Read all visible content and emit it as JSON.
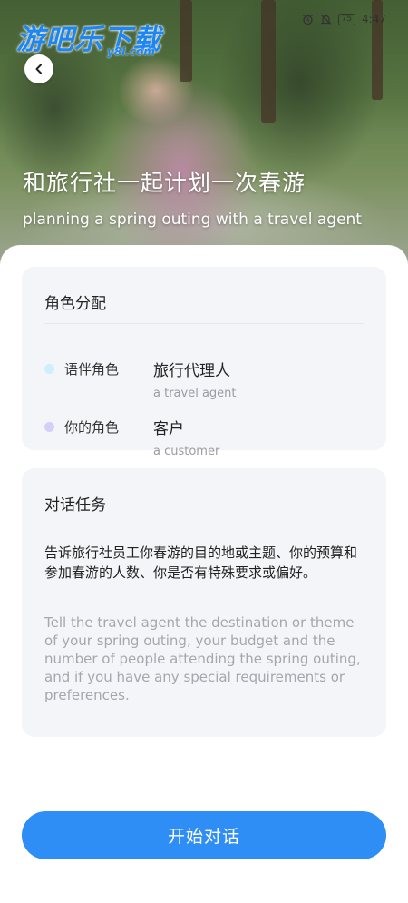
{
  "watermark": {
    "logo_text": "游吧乐下载",
    "logo_sub": "y8l.com"
  },
  "status_bar": {
    "alarm_icon": "alarm-icon",
    "mute_icon": "bell-off-icon",
    "battery_level": "75",
    "time": "4:47"
  },
  "header": {
    "back_icon": "chevron-left-icon",
    "title": "和旅行社一起计划一次春游",
    "subtitle": "planning a spring outing with a travel agent"
  },
  "roles_card": {
    "title": "角色分配",
    "roles": [
      {
        "label": "语伴角色",
        "name": "旅行代理人",
        "english": "a travel agent",
        "dot_color": "#cfeffb"
      },
      {
        "label": "你的角色",
        "name": "客户",
        "english": "a customer",
        "dot_color": "#d3cff7"
      }
    ]
  },
  "task_card": {
    "title": "对话任务",
    "chinese": "告诉旅行社员工你春游的目的地或主题、你的预算和参加春游的人数、你是否有特殊要求或偏好。",
    "english": "Tell the travel agent the destination or theme of your spring outing, your budget and the number of people attending the spring outing, and if you have any special requirements or preferences."
  },
  "action": {
    "start_label": "开始对话"
  },
  "colors": {
    "accent": "#2f8ef5",
    "card_bg": "#f4f5f8"
  }
}
